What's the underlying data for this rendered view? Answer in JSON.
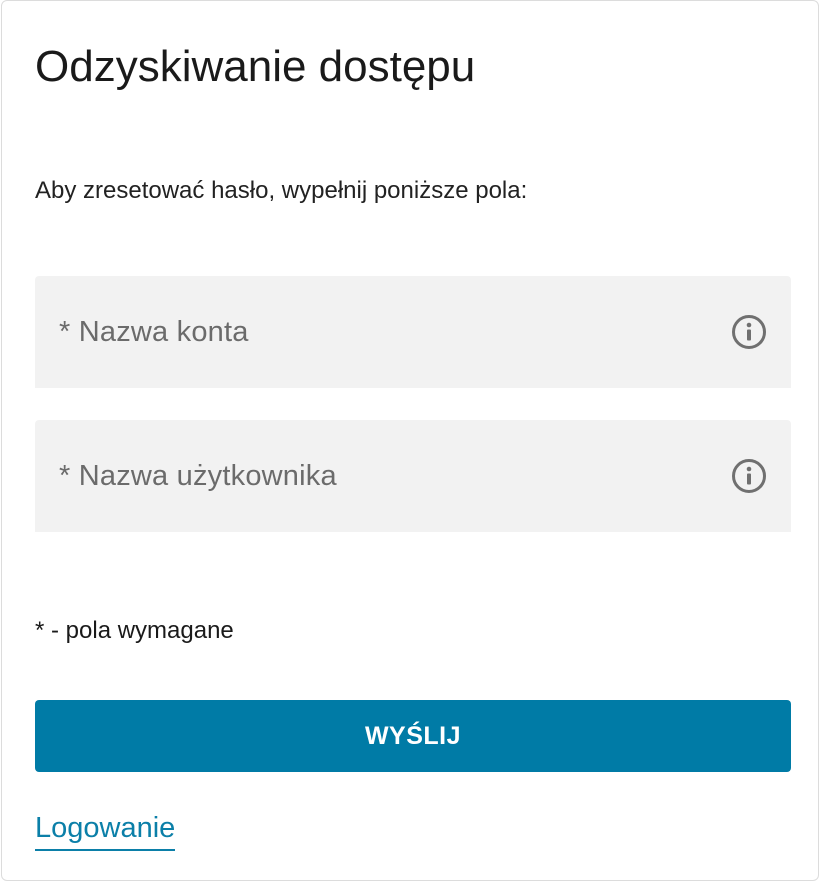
{
  "page": {
    "title": "Odzyskiwanie dostępu",
    "instructions": "Aby zresetować hasło, wypełnij poniższe pola:",
    "required_note": "* - pola wymagane"
  },
  "form": {
    "account_name": {
      "value": "",
      "placeholder": "* Nazwa konta",
      "info_icon": "info-circle-icon"
    },
    "username": {
      "value": "",
      "placeholder": "* Nazwa użytkownika",
      "info_icon": "info-circle-icon"
    },
    "submit_label": "WYŚLIJ"
  },
  "links": {
    "login_label": "Logowanie"
  },
  "colors": {
    "primary": "#007ba6",
    "link": "#0b7fa8",
    "field_background": "#f2f2f2",
    "icon": "#707070"
  }
}
